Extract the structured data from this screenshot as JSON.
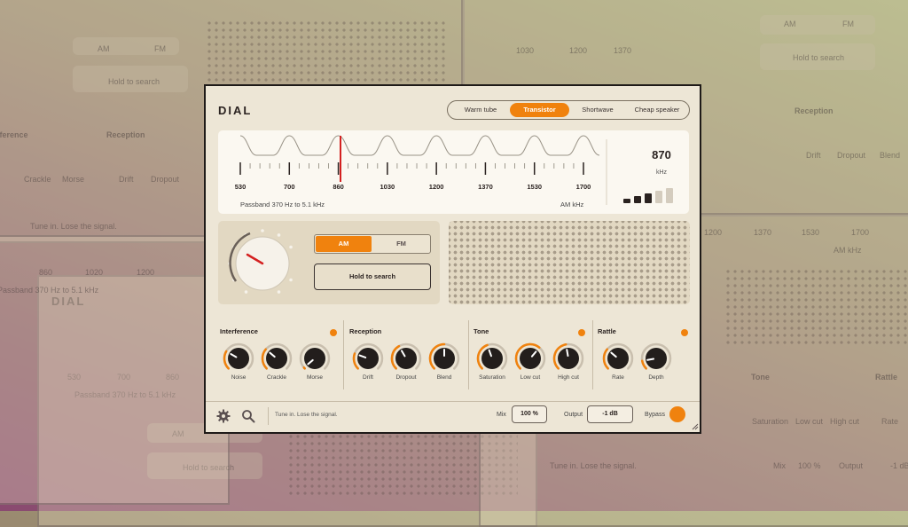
{
  "app": {
    "title": "DIAL",
    "presets": [
      "Warm tube",
      "Transistor",
      "Shortwave",
      "Cheap speaker"
    ],
    "active_preset": "Transistor",
    "dial": {
      "scale_labels": [
        "530",
        "700",
        "860",
        "1030",
        "1200",
        "1370",
        "1530",
        "1700"
      ],
      "frequency": "870",
      "frequency_unit": "kHz",
      "passband_text": "Passband 370 Hz to 5.1 kHz",
      "band_unit_text": "AM  kHz",
      "signal_strength_bars": 3
    },
    "band": {
      "options": [
        "AM",
        "FM"
      ],
      "selected": "AM"
    },
    "hold_button_label": "Hold to search",
    "sections": [
      {
        "name": "Interference",
        "knobs": [
          "Noise",
          "Crackle",
          "Morse"
        ]
      },
      {
        "name": "Reception",
        "knobs": [
          "Drift",
          "Dropout",
          "Blend"
        ]
      },
      {
        "name": "Tone",
        "knobs": [
          "Saturation",
          "Low cut",
          "High cut"
        ]
      },
      {
        "name": "Rattle",
        "knobs": [
          "Rate",
          "Depth"
        ]
      }
    ],
    "footer": {
      "status_text": "Tune in. Lose the signal.",
      "mix_label": "Mix",
      "mix_value": "100 %",
      "output_label": "Output",
      "output_value": "-1 dB",
      "bypass_label": "Bypass"
    }
  },
  "background": {
    "ghost_texts": [
      "Passband 370 Hz to 5.1 kHz",
      "Tune in. Lose the signal.",
      "Hold to search",
      "AM",
      "FM",
      "AM  kHz",
      "Interference",
      "Reception",
      "Tone",
      "Rattle",
      "Crackle",
      "Morse",
      "Drift",
      "Dropout",
      "Blend",
      "Saturation",
      "Low cut",
      "High cut",
      "Rate",
      "Mix",
      "100 %",
      "Output",
      "-1 dB",
      "DIAL",
      "530",
      "700",
      "860",
      "1020",
      "1200",
      "1370",
      "1030",
      "1530",
      "1700"
    ]
  },
  "colors": {
    "accent": "#f0820e",
    "panel": "#ede6d6",
    "needle": "#d42020"
  }
}
